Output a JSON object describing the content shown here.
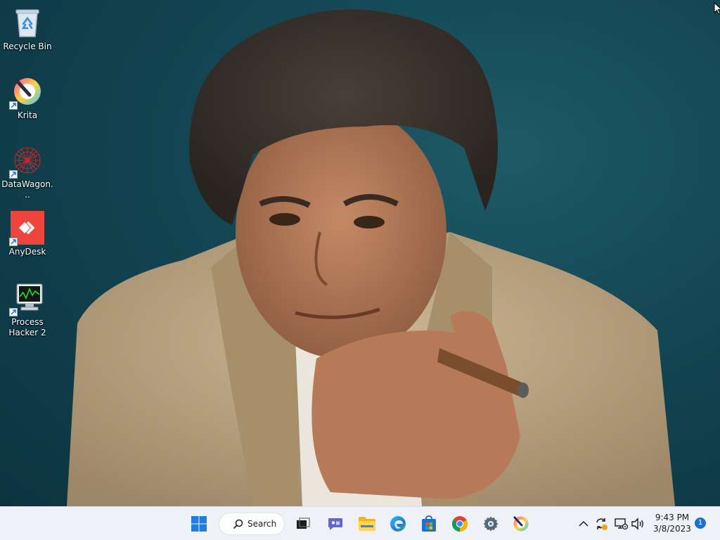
{
  "desktop": {
    "icons": [
      {
        "label": "Recycle Bin",
        "icon": "recycle-bin-icon",
        "shortcut": false
      },
      {
        "label": "Krita",
        "icon": "krita-icon",
        "shortcut": true
      },
      {
        "label": "DataWagon...",
        "icon": "datawagon-icon",
        "shortcut": true
      },
      {
        "label": "AnyDesk",
        "icon": "anydesk-icon",
        "shortcut": true,
        "color": "#ef443b"
      },
      {
        "label": "Process Hacker 2",
        "icon": "process-hacker-icon",
        "shortcut": true
      }
    ],
    "wallpaper": "portrait-photo"
  },
  "taskbar": {
    "start_icon": "windows-start-icon",
    "search_label": "Search",
    "pinned": [
      {
        "name": "task-view",
        "icon": "task-view-icon"
      },
      {
        "name": "teams-chat",
        "icon": "teams-chat-icon"
      },
      {
        "name": "file-explorer",
        "icon": "folder-icon"
      },
      {
        "name": "edge",
        "icon": "edge-icon"
      },
      {
        "name": "microsoft-store",
        "icon": "store-icon"
      },
      {
        "name": "chrome",
        "icon": "chrome-icon"
      },
      {
        "name": "settings",
        "icon": "gear-icon"
      },
      {
        "name": "krita",
        "icon": "krita-icon"
      }
    ],
    "tray": {
      "overflow_icon": "chevron-up-icon",
      "icons": [
        "sync-icon",
        "network-icon",
        "volume-icon"
      ]
    },
    "clock": {
      "time": "9:43 PM",
      "date": "3/8/2023"
    },
    "notification_count": "1",
    "accent": "#1f6fd1"
  }
}
